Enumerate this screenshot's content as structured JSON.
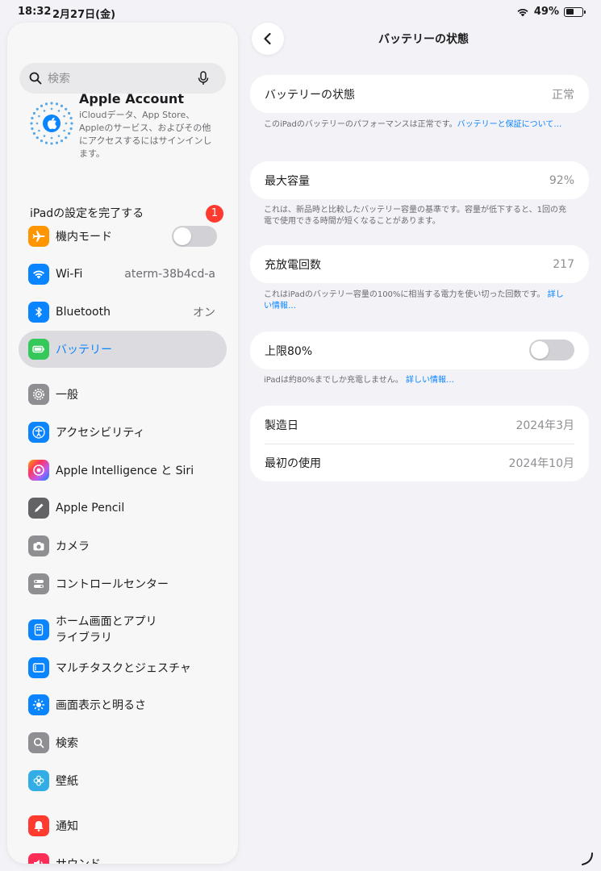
{
  "status": {
    "time": "18:32",
    "date": "2月27日(金)",
    "battery_percent": "49%",
    "battery_level": 0.49
  },
  "sidebar": {
    "search_placeholder": "検索",
    "account": {
      "title": "Apple Account",
      "description": "iCloudデータ、App Store、Appleのサービス、およびその他にアクセスするにはサインインします。"
    },
    "setup": {
      "label": "iPadの設定を完了する",
      "badge": "1"
    },
    "items": [
      {
        "label": "機内モード",
        "icon": "airplane-icon",
        "color": "#ff9500"
      },
      {
        "label": "Wi-Fi",
        "value": "aterm-38b4cd-a",
        "icon": "wifi-icon",
        "color": "#0a84ff"
      },
      {
        "label": "Bluetooth",
        "value": "オン",
        "icon": "bluetooth-icon",
        "color": "#0a84ff"
      },
      {
        "label": "バッテリー",
        "icon": "battery-icon",
        "color": "#34c759"
      },
      {
        "label": "一般",
        "icon": "gear-icon",
        "color": "#8e8e93"
      },
      {
        "label": "アクセシビリティ",
        "icon": "accessibility-icon",
        "color": "#0a84ff"
      },
      {
        "label": "Apple Intelligence と Siri",
        "icon": "siri-icon",
        "color": "#c44bd6"
      },
      {
        "label": "Apple Pencil",
        "icon": "pencil-icon",
        "color": "#636366"
      },
      {
        "label": "カメラ",
        "icon": "camera-icon",
        "color": "#8e8e93"
      },
      {
        "label": "コントロールセンター",
        "icon": "control-center-icon",
        "color": "#8e8e93"
      },
      {
        "label": "ホーム画面とアプリ",
        "label2": "ライブラリ",
        "icon": "home-screen-icon",
        "color": "#0a84ff"
      },
      {
        "label": "マルチタスクとジェスチャ",
        "icon": "multitasking-icon",
        "color": "#0a84ff"
      },
      {
        "label": "画面表示と明るさ",
        "icon": "brightness-icon",
        "color": "#0a84ff"
      },
      {
        "label": "検索",
        "icon": "search-icon",
        "color": "#8e8e93"
      },
      {
        "label": "壁紙",
        "icon": "wallpaper-icon",
        "color": "#32ade6"
      },
      {
        "label": "通知",
        "icon": "notification-icon",
        "color": "#ff3b30"
      },
      {
        "label": "サウンド",
        "icon": "sound-icon",
        "color": "#ff2d55"
      }
    ]
  },
  "detail": {
    "title": "バッテリーの状態",
    "health": {
      "label": "バッテリーの状態",
      "value": "正常"
    },
    "health_note": "このiPadのバッテリーのパフォーマンスは正常です。",
    "health_link": "バッテリーと保証について…",
    "capacity": {
      "label": "最大容量",
      "value": "92%"
    },
    "capacity_note": "これは、新品時と比較したバッテリー容量の基準です。容量が低下すると、1回の充電で使用できる時間が短くなることがあります。",
    "cycles": {
      "label": "充放電回数",
      "value": "217"
    },
    "cycles_note": "これはiPadのバッテリー容量の100%に相当する電力を使い切った回数です。",
    "cycles_link": "詳しい情報…",
    "limit": {
      "label": "上限80%"
    },
    "limit_note": "iPadは約80%までしか充電しません。",
    "limit_link": "詳しい情報…",
    "manufacture": {
      "label": "製造日",
      "value": "2024年3月"
    },
    "first_use": {
      "label": "最初の使用",
      "value": "2024年10月"
    }
  }
}
